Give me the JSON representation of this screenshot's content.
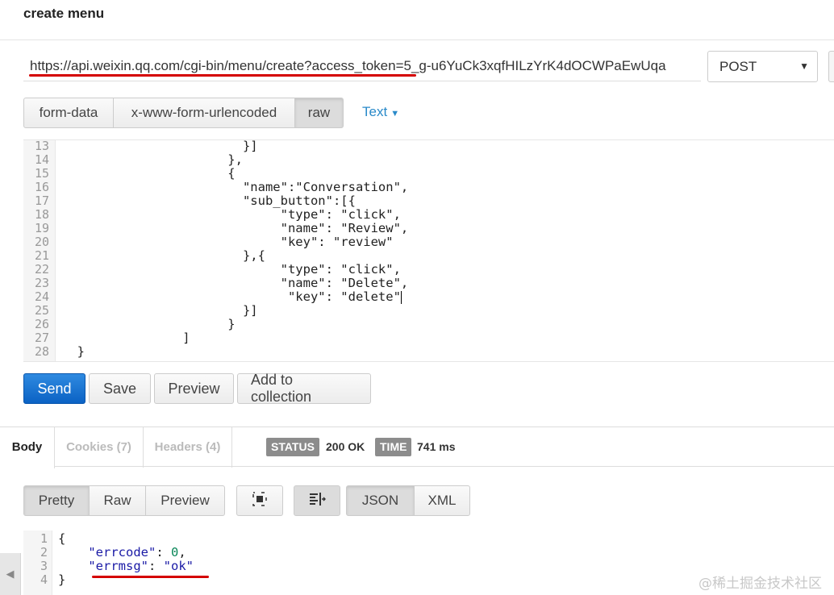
{
  "header": {
    "title": "create menu"
  },
  "request": {
    "url": "https://api.weixin.qq.com/cgi-bin/menu/create?access_token=5_g-u6YuCk3xqfHILzYrK4dOCWPaEwUqa",
    "method": "POST",
    "body_modes": [
      "form-data",
      "x-www-form-urlencoded",
      "raw"
    ],
    "active_body_mode": "raw",
    "raw_type": "Text"
  },
  "editor": {
    "lines": [
      {
        "n": "13",
        "text": "                        }]"
      },
      {
        "n": "14",
        "text": "                      },"
      },
      {
        "n": "15",
        "text": "                      {"
      },
      {
        "n": "16",
        "text": "                        \"name\":\"Conversation\","
      },
      {
        "n": "17",
        "text": "                        \"sub_button\":[{"
      },
      {
        "n": "18",
        "text": "                             \"type\": \"click\","
      },
      {
        "n": "19",
        "text": "                             \"name\": \"Review\","
      },
      {
        "n": "20",
        "text": "                             \"key\": \"review\""
      },
      {
        "n": "21",
        "text": "                        },{"
      },
      {
        "n": "22",
        "text": "                             \"type\": \"click\","
      },
      {
        "n": "23",
        "text": "                             \"name\": \"Delete\","
      },
      {
        "n": "24",
        "text": "                              \"key\": \"delete\""
      },
      {
        "n": "25",
        "text": "                        }]"
      },
      {
        "n": "26",
        "text": "                      }"
      },
      {
        "n": "27",
        "text": "                ]"
      },
      {
        "n": "28",
        "text": "  }"
      }
    ]
  },
  "actions": {
    "send": "Send",
    "save": "Save",
    "preview": "Preview",
    "add_to_collection": "Add to collection"
  },
  "response": {
    "tabs": {
      "body": "Body",
      "cookies": "Cookies (7)",
      "headers": "Headers (4)"
    },
    "status_label": "STATUS",
    "status_value": "200 OK",
    "time_label": "TIME",
    "time_value": "741 ms",
    "view_modes": [
      "Pretty",
      "Raw",
      "Preview"
    ],
    "active_view_mode": "Pretty",
    "formats": [
      "JSON",
      "XML"
    ],
    "active_format": "JSON",
    "body_lines": [
      {
        "n": "1",
        "text": "{"
      },
      {
        "n": "2",
        "key": "\"errcode\"",
        "sep": ": ",
        "value": "0",
        "tail": ","
      },
      {
        "n": "3",
        "key": "\"errmsg\"",
        "sep": ": ",
        "value": "\"ok\"",
        "tail": ""
      },
      {
        "n": "4",
        "text": "}"
      }
    ]
  },
  "watermark": "@稀土掘金技术社区",
  "colors": {
    "send_button": "#0b62c4",
    "underline": "#d40000",
    "link": "#2a8ac9",
    "pill": "#8c8c8c"
  }
}
